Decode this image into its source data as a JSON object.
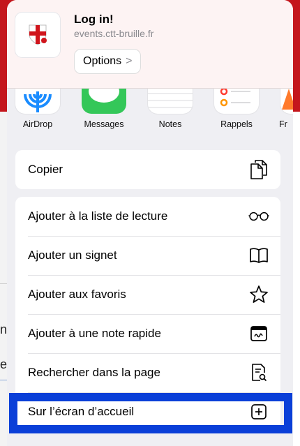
{
  "header": {
    "title": "Log in!",
    "url": "events.ctt-bruille.fr",
    "options_label": "Options",
    "options_chevron": ">",
    "site_icon": "red-cross-shield-icon"
  },
  "apps": [
    {
      "label": "AirDrop",
      "icon": "airdrop-icon"
    },
    {
      "label": "Messages",
      "icon": "messages-icon"
    },
    {
      "label": "Notes",
      "icon": "notes-icon"
    },
    {
      "label": "Rappels",
      "icon": "reminders-icon"
    },
    {
      "label": "Fr",
      "icon": "app-icon"
    }
  ],
  "group1": {
    "copy_label": "Copier",
    "copy_icon": "copy-icon"
  },
  "group2": {
    "items": [
      {
        "label": "Ajouter à la liste de lecture",
        "icon": "glasses-icon"
      },
      {
        "label": "Ajouter un signet",
        "icon": "book-icon"
      },
      {
        "label": "Ajouter aux favoris",
        "icon": "star-icon"
      },
      {
        "label": "Ajouter à une note rapide",
        "icon": "quick-note-icon"
      },
      {
        "label": "Rechercher dans la page",
        "icon": "find-in-page-icon"
      },
      {
        "label": "Sur l’écran d’accueil",
        "icon": "add-square-icon"
      }
    ]
  },
  "background": {
    "left_chars": [
      "n",
      "e"
    ]
  },
  "colors": {
    "accent_blue": "#0a3fd8",
    "brand_red": "#c4161c",
    "messages_green": "#34c759",
    "airdrop_blue": "#1a8cff"
  }
}
